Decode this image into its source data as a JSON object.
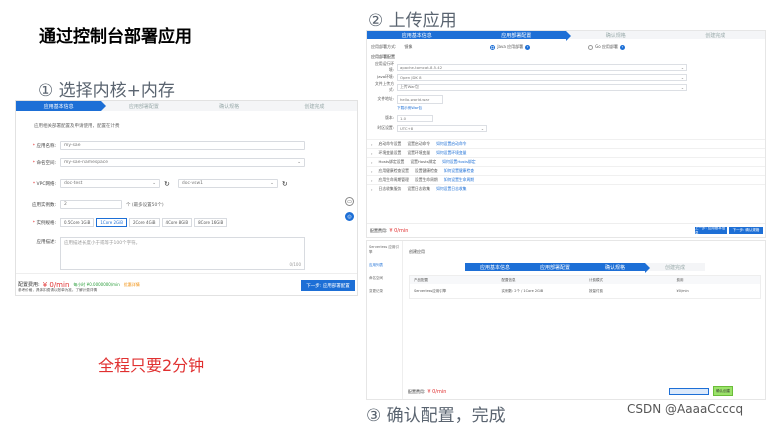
{
  "main_title": "通过控制台部署应用",
  "step1_label": "① 选择内核+内存",
  "step2_label": "② 上传应用",
  "step3_label": "③ 确认配置，完成",
  "note": "全程只要2分钟",
  "watermark": "CSDN @AaaaCcccq",
  "colors": {
    "accent": "#1d6fd6",
    "price_red": "#e03030"
  },
  "shot1": {
    "steps": [
      "应用基本信息",
      "应用部署配置",
      "确认规格",
      "创建完成"
    ],
    "info": "应用相关部署配置及申请使用，配置在计费",
    "fields": {
      "app_name_label": "应用名称:",
      "app_name_value": "my-sae",
      "namespace_label": "命名空间:",
      "namespace_value": "my-sae-namespace",
      "vpc_label": "VPC网络:",
      "vpc_value": "doc-test",
      "vsw_value": "doc-vsw1",
      "instances_label": "应用实例数:",
      "instances_value": "2",
      "instances_suffix": "个 (最多设置50个)",
      "spec_label": "实例规格:",
      "specs": [
        "0.5Core 1GiB",
        "1Core 2GiB",
        "2Core 4GiB",
        "4Core 8GiB",
        "8Core 16GiB"
      ],
      "desc_label": "应用描述:",
      "desc_placeholder": "应用描述长度小于或等于100个字符。",
      "desc_count": "0/100"
    },
    "fee_label": "配置费用:",
    "fee_price": "¥ 0/min",
    "fee_detail": "每小时 ¥0.0000000/min",
    "fee_orange": "优惠详情",
    "fee_note": "参考价格，具体扣费请以账单为准。了解计费详情",
    "next_button": "下一步: 应用部署配置"
  },
  "shot2": {
    "steps": [
      "应用基本信息",
      "应用部署配置",
      "确认规格",
      "创建完成"
    ],
    "deploy_label": "应用部署方式:",
    "deploy_value": "镜像",
    "option_a": "Java 应用部署",
    "option_b": "Go 应用部署",
    "section": "应用部署配置",
    "rows": [
      {
        "label": "应用运行环境:",
        "value": "apache-tomcat-8.5.42"
      },
      {
        "label": "Java环境:",
        "value": "Open JDK 8"
      },
      {
        "label": "文件上传方式:",
        "value": "上传War包"
      },
      {
        "label": "文件地址:",
        "value": "hello-world.war"
      },
      {
        "label": "版本:",
        "value": "1.0"
      },
      {
        "label": "时区设置:",
        "value": "UTC+8"
      }
    ],
    "upload_link": "下载示例War包",
    "collapsibles": [
      {
        "title": "启动命令设置",
        "desc": "设置启动命令",
        "link": "如何设置启动命令"
      },
      {
        "title": "环境变量设置",
        "desc": "设置环境变量",
        "link": "如何设置环境变量"
      },
      {
        "title": "Hosts绑定设置",
        "desc": "设置Hosts绑定",
        "link": "如何设置Hosts绑定"
      },
      {
        "title": "应用健康检查设置",
        "desc": "设置健康检查",
        "link": "如何设置健康检查"
      },
      {
        "title": "应用生命周期管理",
        "desc": "设置生命周期",
        "link": "如何设置生命周期"
      },
      {
        "title": "日志收集服务",
        "desc": "设置日志收集",
        "link": "如何设置日志收集"
      }
    ],
    "fee_price": "¥ 0/min",
    "back_button": "上一步: 应用基本信息",
    "next_button": "下一步: 确认规格"
  },
  "shot3": {
    "sidebar": [
      "Serverless 应用引擎",
      "应用列表",
      "命名空间",
      "变更记录"
    ],
    "title": "创建应用",
    "steps": [
      "应用基本信息",
      "应用部署配置",
      "确认规格",
      "创建完成"
    ],
    "table_headers": [
      "产品配置",
      "配置信息",
      "计费模式",
      "费用"
    ],
    "table_row": [
      "Serverless应用引擎",
      "实例数: 2个 / 1Core 2GiB",
      "按量付费",
      "¥0/min"
    ],
    "fee_price": "¥ 0/min",
    "confirm_button": "确认创建"
  }
}
